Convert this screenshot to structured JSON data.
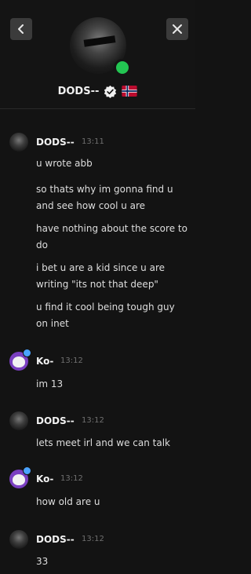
{
  "header": {
    "name": "DODS--"
  },
  "messages": [
    {
      "user": "DODS--",
      "time": "13:11",
      "lines": [
        "u wrote abb",
        "so thats why im gonna find u and see how cool u are",
        "have nothing about the score to do",
        "i bet u are a kid since u are writing \"its not that deep\"",
        "u find it cool being tough guy on inet"
      ]
    },
    {
      "user": "Ko-",
      "time": "13:12",
      "lines": [
        "im 13"
      ]
    },
    {
      "user": "DODS--",
      "time": "13:12",
      "lines": [
        "lets meet irl and we can talk"
      ]
    },
    {
      "user": "Ko-",
      "time": "13:12",
      "lines": [
        "how old are u"
      ]
    },
    {
      "user": "DODS--",
      "time": "13:12",
      "lines": [
        "33"
      ]
    }
  ]
}
